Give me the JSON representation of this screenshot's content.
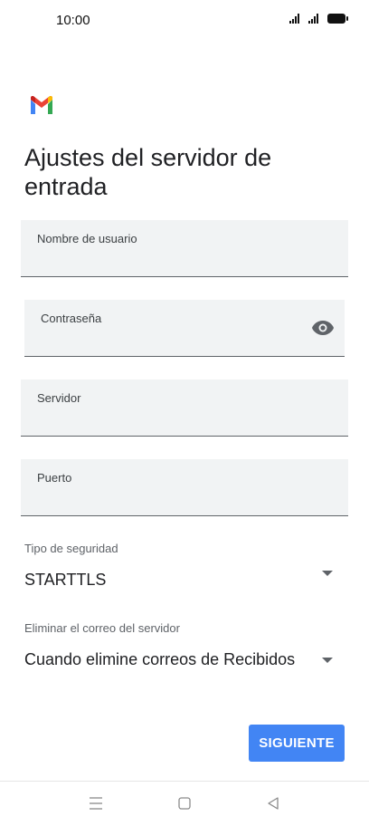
{
  "status_bar": {
    "time": "10:00"
  },
  "page": {
    "title": "Ajustes del servidor de entrada"
  },
  "fields": {
    "username": {
      "label": "Nombre de usuario",
      "value": ""
    },
    "password": {
      "label": "Contraseña",
      "value": ""
    },
    "server": {
      "label": "Servidor",
      "value": ""
    },
    "port": {
      "label": "Puerto",
      "value": ""
    }
  },
  "security": {
    "label": "Tipo de seguridad",
    "value": "STARTTLS"
  },
  "delete_mail": {
    "label": "Eliminar el correo del servidor",
    "value": "Cuando elimine correos de Recibidos"
  },
  "actions": {
    "next_label": "SIGUIENTE"
  },
  "colors": {
    "accent": "#4285f4",
    "field_bg": "#f1f3f4"
  }
}
